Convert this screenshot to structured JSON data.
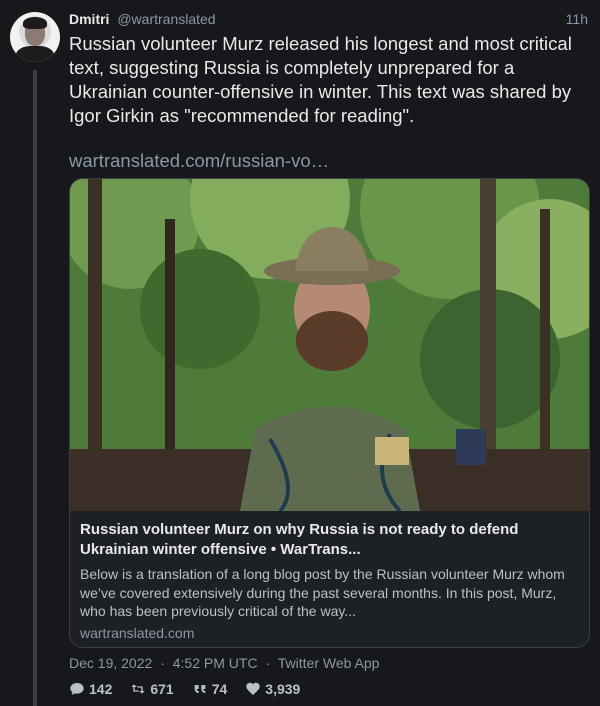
{
  "tweet": {
    "author_name": "Dmitri",
    "author_handle": "@wartranslated",
    "time_ago": "11h",
    "text": "Russian volunteer Murz released his longest and most critical text, suggesting Russia is completely unprepared for a Ukrainian counter-offensive in winter. This text was shared by Igor Girkin as \"recommended for reading\".",
    "link": "wartranslated.com/russian-vo…"
  },
  "card": {
    "title": "Russian volunteer Murz on why Russia is not ready to defend Ukrainian winter offensive • WarTrans...",
    "description": "Below is a translation of a long blog post by the Russian volunteer Murz whom we’ve covered extensively during the past several months. In this post, Murz, who has been previously critical of the way...",
    "domain": "wartranslated.com"
  },
  "meta": {
    "date": "Dec 19, 2022",
    "time": "4:52 PM UTC",
    "source": "Twitter Web App",
    "separator": "·"
  },
  "stats": {
    "replies": "142",
    "retweets": "671",
    "quotes": "74",
    "likes": "3,939"
  },
  "icons": {
    "reply": "comment-icon",
    "retweet": "retweet-icon",
    "quote": "quote-icon",
    "like": "heart-icon"
  }
}
